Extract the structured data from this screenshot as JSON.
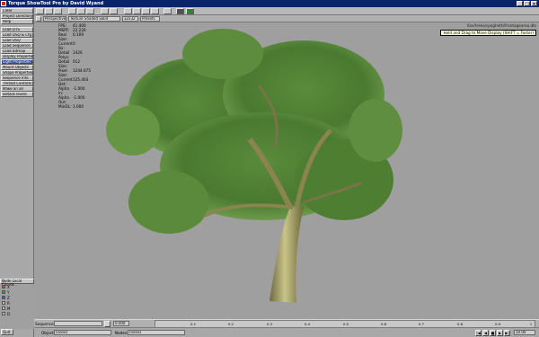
{
  "window": {
    "title": "Torque ShowTool Pro by David Wyand"
  },
  "sidebar": {
    "top_dropdowns": [
      "Clear",
      "Project Directory",
      "Help"
    ],
    "buttons": [
      "Load DTS",
      "Load DSQ & Cfg",
      "Load DSQ",
      "Load Sequence",
      "Load Bitmap",
      "Display Properties",
      "Light Properties",
      "Mount Objects",
      "Shape Properties",
      "Sequence Info",
      "Thread Controls",
      "Make an all",
      "Details levels"
    ],
    "selected_index": 6,
    "node_panel": {
      "header": "Node Local Coords",
      "axes": [
        {
          "label": "X",
          "color": "#d04040"
        },
        {
          "label": "Y",
          "color": "#40a040"
        },
        {
          "label": "Z",
          "color": "#4060d0"
        },
        {
          "label": "R",
          "color": "#c0c0c0"
        },
        {
          "label": "M",
          "color": "#c0c0c0"
        },
        {
          "label": "D",
          "color": "#c0c0c0"
        }
      ]
    },
    "quit_label": "Quit"
  },
  "viewbar": {
    "camera": "Perspective",
    "shading": "Texture Shaded Solid",
    "grid": "32x32",
    "presets": "Presets"
  },
  "viewport": {
    "path": "/lan/trees/spaghetti/frontagearea.dts",
    "tooltip": "Hold and Drag to Move Display (SHIFT = Faster)",
    "stats": [
      {
        "label": "FPS:",
        "value": "41.400"
      },
      {
        "label": "MSPF:",
        "value": "22.226"
      },
      {
        "label": "Real Size:",
        "value": "0.109"
      },
      {
        "label": "Current Bx:",
        "value": "0"
      },
      {
        "label": "Detail Polys:",
        "value": "1426"
      },
      {
        "label": "Detail Size:",
        "value": "012"
      },
      {
        "label": "Pixel Size:",
        "value": "1244.675"
      },
      {
        "label": "Current Det:",
        "value": "125.403"
      },
      {
        "label": "Alpha In:",
        "value": "-1.000"
      },
      {
        "label": "Alpha Out:",
        "value": "-1.000"
      },
      {
        "label": "MinDL:",
        "value": "1.000"
      }
    ]
  },
  "timeline": {
    "sequence_label": "Sequence:",
    "objects_label": "Objects:",
    "objects_value": "(none)",
    "nodes_label": "Nodes:",
    "nodes_value": "(none)",
    "time_value": "0.000",
    "ticks": [
      "0.1",
      "0.2",
      "0.3",
      "0.4",
      "0.5",
      "0.6",
      "0.7",
      "0.8",
      "0.9",
      "1"
    ],
    "end_value": "10.00"
  },
  "colors": {
    "title_bar": "#0a246a",
    "viewport_bg": "#9f9f9f",
    "selected_button": "#2a4a9a"
  }
}
